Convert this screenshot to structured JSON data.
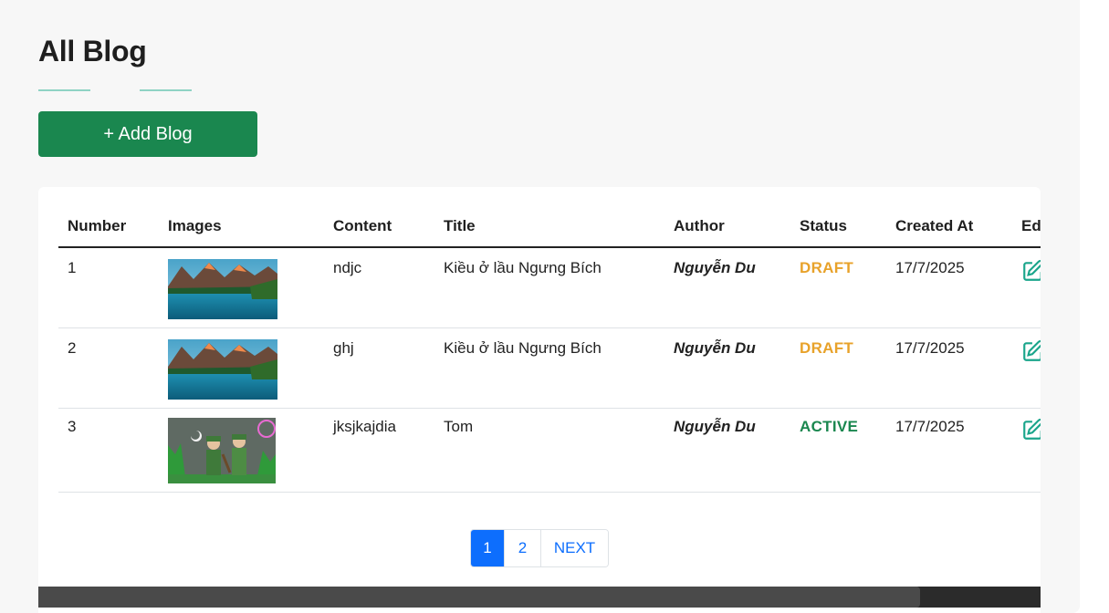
{
  "header": {
    "title": "All Blog"
  },
  "actions": {
    "add_label": "+ Add Blog"
  },
  "colors": {
    "primary_green": "#1a874f",
    "draft": "#e8a22a",
    "active": "#1a874f",
    "link_blue": "#0d6efd"
  },
  "table": {
    "columns": [
      "Number",
      "Images",
      "Content",
      "Title",
      "Author",
      "Status",
      "Created At",
      "Ed"
    ],
    "rows": [
      {
        "number": "1",
        "image": "mountain-lake-photo",
        "content": "ndjc",
        "title": "Kiều ở lầu Ngưng Bích",
        "author": "Nguyễn Du",
        "status": "DRAFT",
        "created_at": "17/7/2025",
        "edit_icon": "edit-icon"
      },
      {
        "number": "2",
        "image": "mountain-lake-photo",
        "content": "ghj",
        "title": "Kiều ở lầu Ngưng Bích",
        "author": "Nguyễn Du",
        "status": "DRAFT",
        "created_at": "17/7/2025",
        "edit_icon": "edit-icon"
      },
      {
        "number": "3",
        "image": "soldiers-illustration",
        "content": "jksjkajdia",
        "title": "Tom",
        "author": "Nguyễn Du",
        "status": "ACTIVE",
        "created_at": "17/7/2025",
        "edit_icon": "edit-icon"
      }
    ]
  },
  "pagination": {
    "pages": [
      "1",
      "2"
    ],
    "current": "1",
    "next_label": "NEXT"
  },
  "scrollbar": {
    "position_fraction": 0.88
  }
}
